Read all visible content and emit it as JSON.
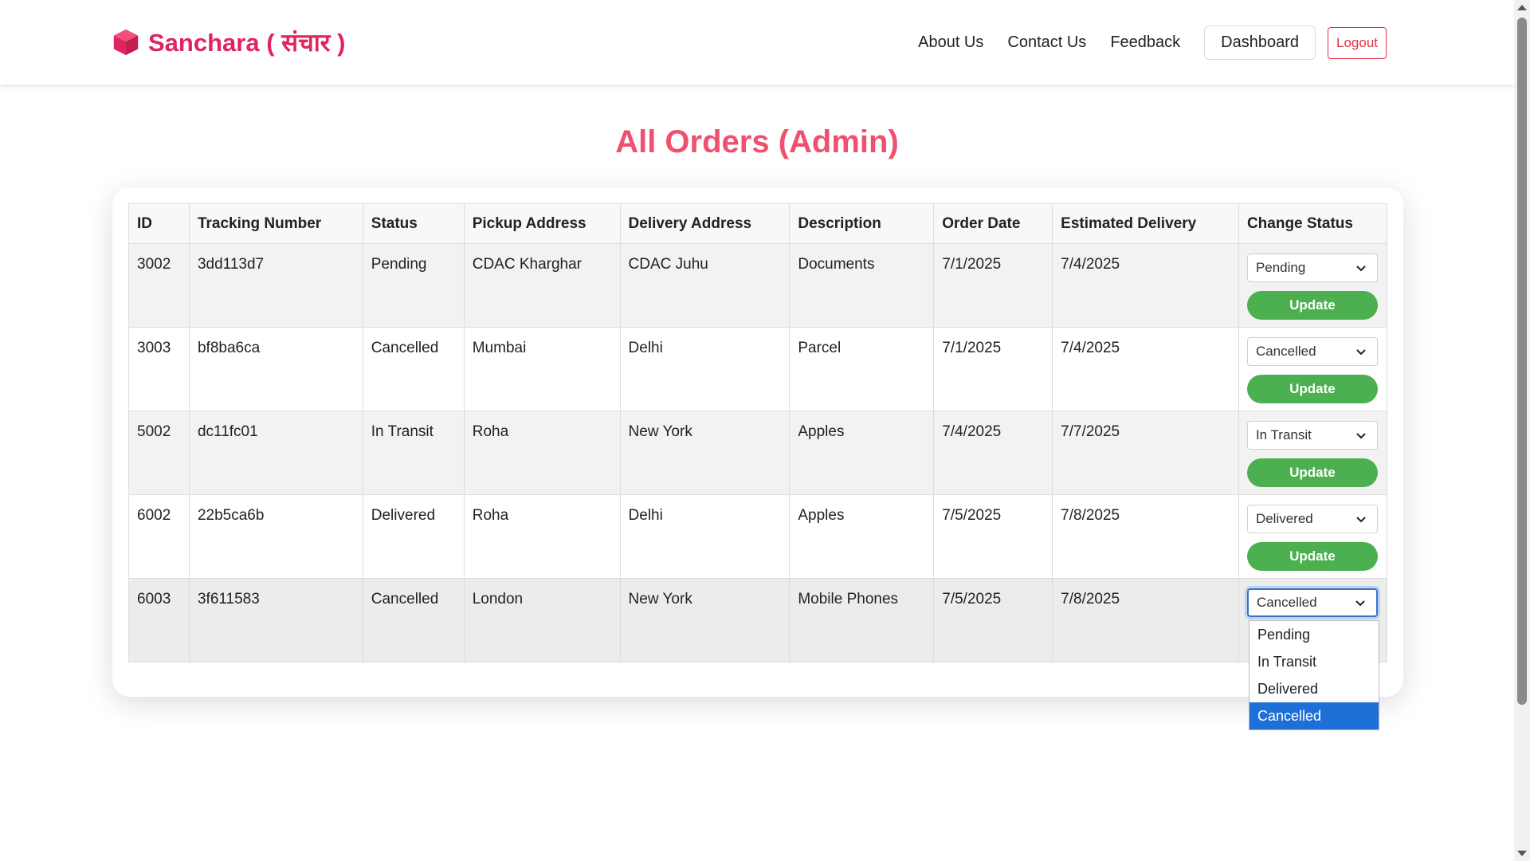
{
  "brand": {
    "name": "Sanchara ( संचार )",
    "icon": "cube-icon",
    "color": "#e0245e"
  },
  "nav": {
    "links": [
      "About Us",
      "Contact Us",
      "Feedback"
    ],
    "dashboard_label": "Dashboard",
    "logout_label": "Logout"
  },
  "page": {
    "title": "All Orders (Admin)"
  },
  "table": {
    "headers": [
      "ID",
      "Tracking Number",
      "Status",
      "Pickup Address",
      "Delivery Address",
      "Description",
      "Order Date",
      "Estimated Delivery",
      "Change Status"
    ],
    "rows": [
      {
        "id": "3002",
        "tracking": "3dd113d7",
        "status": "Pending",
        "pickup": "CDAC Kharghar",
        "delivery": "CDAC Juhu",
        "description": "Documents",
        "order_date": "7/1/2025",
        "est_delivery": "7/4/2025",
        "select_value": "Pending"
      },
      {
        "id": "3003",
        "tracking": "bf8ba6ca",
        "status": "Cancelled",
        "pickup": "Mumbai",
        "delivery": "Delhi",
        "description": "Parcel",
        "order_date": "7/1/2025",
        "est_delivery": "7/4/2025",
        "select_value": "Cancelled"
      },
      {
        "id": "5002",
        "tracking": "dc11fc01",
        "status": "In Transit",
        "pickup": "Roha",
        "delivery": "New York",
        "description": "Apples",
        "order_date": "7/4/2025",
        "est_delivery": "7/7/2025",
        "select_value": "In Transit"
      },
      {
        "id": "6002",
        "tracking": "22b5ca6b",
        "status": "Delivered",
        "pickup": "Roha",
        "delivery": "Delhi",
        "description": "Apples",
        "order_date": "7/5/2025",
        "est_delivery": "7/8/2025",
        "select_value": "Delivered"
      },
      {
        "id": "6003",
        "tracking": "3f611583",
        "status": "Cancelled",
        "pickup": "London",
        "delivery": "New York",
        "description": "Mobile Phones",
        "order_date": "7/5/2025",
        "est_delivery": "7/8/2025",
        "select_value": "Cancelled"
      }
    ],
    "update_label": "Update"
  },
  "status_dropdown": {
    "options": [
      "Pending",
      "In Transit",
      "Delivered",
      "Cancelled"
    ],
    "selected": "Cancelled"
  },
  "colors": {
    "accent": "#e0245e",
    "title": "#f0506e",
    "update_button": "#4caf50",
    "logout": "#dc3545",
    "selected_option": "#1f6fd8"
  }
}
